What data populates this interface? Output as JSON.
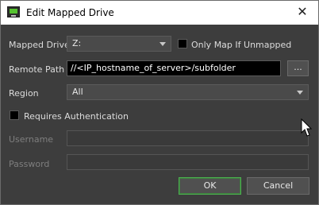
{
  "window": {
    "title": "Edit Mapped Drive",
    "close_glyph": "✕"
  },
  "form": {
    "mapped_drive": {
      "label": "Mapped Drive",
      "value": "Z:"
    },
    "only_map_if_unmapped": {
      "label": "Only Map If Unmapped",
      "checked": false
    },
    "remote_path": {
      "label": "Remote Path",
      "value": "//<IP_hostname_of_server>/subfolder",
      "browse_label": "..."
    },
    "region": {
      "label": "Region",
      "value": "All"
    },
    "requires_authentication": {
      "label": "Requires Authentication",
      "checked": false
    },
    "username": {
      "label": "Username",
      "value": ""
    },
    "password": {
      "label": "Password",
      "value": ""
    }
  },
  "buttons": {
    "ok": "OK",
    "cancel": "Cancel"
  },
  "colors": {
    "title_bar": "#ffffff",
    "dialog_bg": "#3d3d3d",
    "field_bg": "#000000",
    "ok_accent": "#4caf50"
  }
}
